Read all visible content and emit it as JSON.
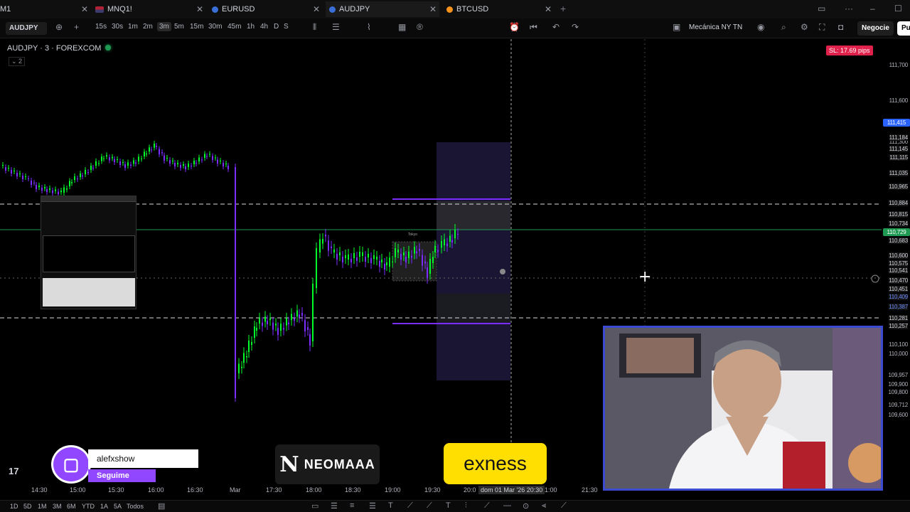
{
  "tabs": [
    {
      "label": "M1",
      "active": false
    },
    {
      "label": "MNQ1!",
      "active": false
    },
    {
      "label": "EURUSD",
      "active": false
    },
    {
      "label": "AUDJPY",
      "active": true
    },
    {
      "label": "BTCUSD",
      "active": false
    }
  ],
  "toolbar": {
    "symbol": "AUDJPY",
    "timeframes": [
      "15s",
      "30s",
      "1m",
      "2m",
      "3m",
      "5m",
      "15m",
      "30m",
      "45m",
      "1h",
      "4h",
      "D",
      "S"
    ],
    "active_timeframe": "3m",
    "template": "Mecánica NY TN",
    "trade_button": "Negocie",
    "publish_button": "Pu"
  },
  "chart": {
    "legend": "AUDJPY · 3 · FOREXCOM",
    "legend_count": "2",
    "sl_badge": "SL: 17.69 pips",
    "price_labels": [
      "111,700",
      "111,600",
      "111,415",
      "111,300",
      "111,184",
      "111,145",
      "111,115",
      "111,035",
      "110,965",
      "110,884",
      "110,815",
      "110,734",
      "110,729",
      "110,683",
      "110,600",
      "110,575",
      "110,541",
      "110,470",
      "110,451",
      "110,409",
      "110,387",
      "110,281",
      "110,257",
      "110,100",
      "110,000",
      "109,957",
      "109,900",
      "109,800",
      "109,712",
      "109,600"
    ],
    "session_label": "Tokyo",
    "time_labels": [
      "14:30",
      "15:00",
      "15:30",
      "16:00",
      "16:30",
      "Mar",
      "17:30",
      "18:00",
      "18:30",
      "19:00",
      "19:30",
      "21:30"
    ],
    "time_cursor": "dom 01 Mar '26  20:30",
    "time_partial_left": "20:0",
    "time_partial_right": "1:00"
  },
  "bottom": {
    "ranges": [
      "1D",
      "5D",
      "1M",
      "3M",
      "6M",
      "YTD",
      "1A",
      "5A",
      "Todos"
    ]
  },
  "overlays": {
    "twitch_name": "alefxshow",
    "twitch_follow": "Seguime",
    "neomaaa": "NEOMAAA",
    "neomaaa_mark": "N",
    "exness": "exness",
    "tv_logo": "17"
  },
  "colors": {
    "bull": "#00ff2a",
    "bear": "#7b2cff",
    "accent_green": "#1e9a52",
    "sl_red": "#e0214b",
    "blue_tag": "#2962ff"
  }
}
